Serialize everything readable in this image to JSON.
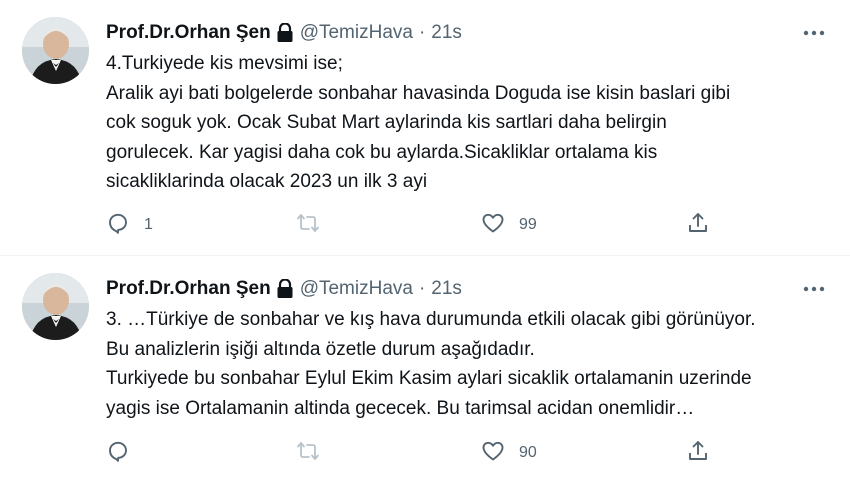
{
  "tweets": [
    {
      "author": "Prof.Dr.Orhan Şen",
      "handle": "@TemizHava",
      "separator": "·",
      "time": "21s",
      "lines": [
        "4.Turkiyede kis mevsimi ise;",
        "Aralik ayi bati bolgelerde sonbahar havasinda Doguda ise kisin baslari gibi",
        "cok soguk yok. Ocak Subat Mart aylarinda kis sartlari daha belirgin",
        "gorulecek. Kar yagisi daha cok bu aylarda.Sicakliklar ortalama kis",
        "sicakliklarinda olacak 2023 un ilk 3 ayi"
      ],
      "reply_count": "1",
      "retweet_count": "",
      "like_count": "99"
    },
    {
      "author": "Prof.Dr.Orhan Şen",
      "handle": "@TemizHava",
      "separator": "·",
      "time": "21s",
      "lines": [
        "3. …Türkiye de sonbahar ve kış hava durumunda etkili olacak gibi görünüyor.",
        "Bu analizlerin işiği altında özetle durum aşağıdadır.",
        "Turkiyede bu sonbahar Eylul Ekim Kasim aylari sicaklik ortalamanin uzerinde",
        "yagis ise Ortalamanin altinda gececek. Bu tarimsal acidan onemlidir…"
      ],
      "reply_count": "",
      "retweet_count": "",
      "like_count": "90"
    }
  ],
  "icons": {
    "lock": "lock-icon",
    "more": "more-icon",
    "reply": "reply-icon",
    "retweet": "retweet-icon",
    "like": "heart-icon",
    "share": "share-icon"
  },
  "colors": {
    "text": "#0f1419",
    "secondary": "#536471",
    "divider": "#eff3f4"
  }
}
